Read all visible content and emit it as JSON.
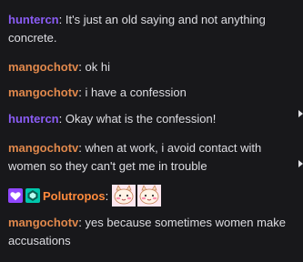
{
  "colors": {
    "background": "#18181b",
    "text": "#efeff1",
    "hunter": "#8a5cf5",
    "mango": "#e0884c",
    "poluto": "#ff8a3c",
    "badge_heart": "#9147ff",
    "badge_gem": "#00c7ac"
  },
  "messages": [
    {
      "user": "huntercn",
      "sep": ":",
      "text": "It's just an old saying and not anything concrete."
    },
    {
      "user": "mangochotv",
      "sep": ":",
      "text": "ok hi"
    },
    {
      "user": "mangochotv",
      "sep": ":",
      "text": "i have a confession"
    },
    {
      "user": "huntercn",
      "sep": ":",
      "text": "Okay what is the confession!"
    },
    {
      "user": "mangochotv",
      "sep": ":",
      "text": "when at work, i avoid contact with women so they can't get me in trouble"
    },
    {
      "user": "Polutropos",
      "sep": ":",
      "text": "",
      "badges": [
        "heart-badge",
        "gem-badge"
      ],
      "emotes": [
        "blushing-cat-emote",
        "blushing-cat-emote"
      ]
    },
    {
      "user": "mangochotv",
      "sep": ":",
      "text": "yes because sometimes women make accusations"
    }
  ]
}
